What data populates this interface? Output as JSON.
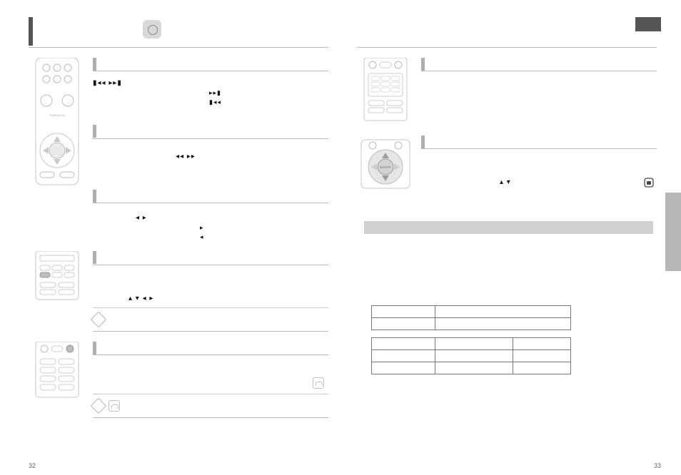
{
  "page_numbers": {
    "left": "32",
    "right": "33"
  },
  "clock_icon": "clock-icon",
  "left_col": {
    "section1": {
      "head": "",
      "glyphs1": "▮◂◂  ▸▸▮",
      "glyphs2": "▸▸▮",
      "glyphs3": "▮◂◂"
    },
    "section2": {
      "head": "",
      "glyphs": "◂◂   ▸▸"
    },
    "section3": {
      "head": "",
      "glyphs1": "◂  ▸",
      "glyphs2": "▸",
      "glyphs3": "◂"
    },
    "section4": {
      "head": "",
      "glyphs": "▴  ▾  ◂  ▸"
    },
    "note1": "",
    "section5": {
      "head": "",
      "hand_note": ""
    },
    "note2": ""
  },
  "right_col": {
    "section1": {
      "head": ""
    },
    "section2": {
      "head": "",
      "glyphs": "▴  ▾"
    },
    "gray_band": "",
    "table1": {
      "rows": [
        [
          "",
          ""
        ],
        [
          "",
          ""
        ]
      ]
    },
    "table2": {
      "rows": [
        [
          "",
          "",
          ""
        ],
        [
          "",
          "",
          ""
        ],
        [
          "",
          "",
          ""
        ]
      ]
    }
  }
}
